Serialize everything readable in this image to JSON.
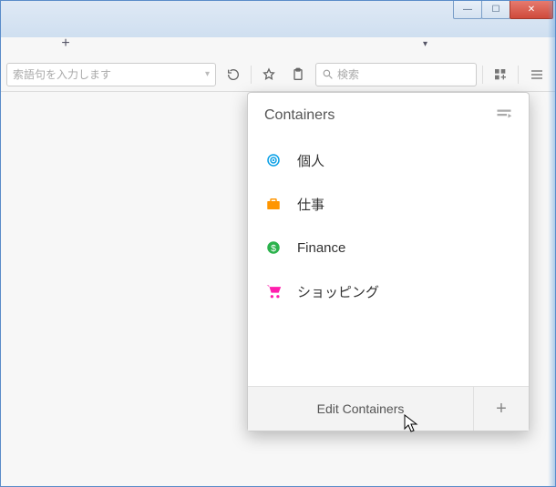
{
  "window": {
    "minimize": "—",
    "maximize": "☐",
    "close": "✕"
  },
  "tabs": {
    "newtab_glyph": "+",
    "dropdown_glyph": "▾"
  },
  "toolbar": {
    "url_placeholder": "索語句を入力します",
    "url_dropdown": "▾",
    "search_placeholder": "検索"
  },
  "panel": {
    "title": "Containers",
    "items": [
      {
        "label": "個人",
        "color": "#0aa0e6",
        "icon": "fingerprint"
      },
      {
        "label": "仕事",
        "color": "#ff9500",
        "icon": "briefcase"
      },
      {
        "label": "Finance",
        "color": "#2bb24c",
        "icon": "dollar"
      },
      {
        "label": "ショッピング",
        "color": "#ff1ead",
        "icon": "cart"
      }
    ],
    "edit_label": "Edit Containers",
    "add_glyph": "+"
  }
}
